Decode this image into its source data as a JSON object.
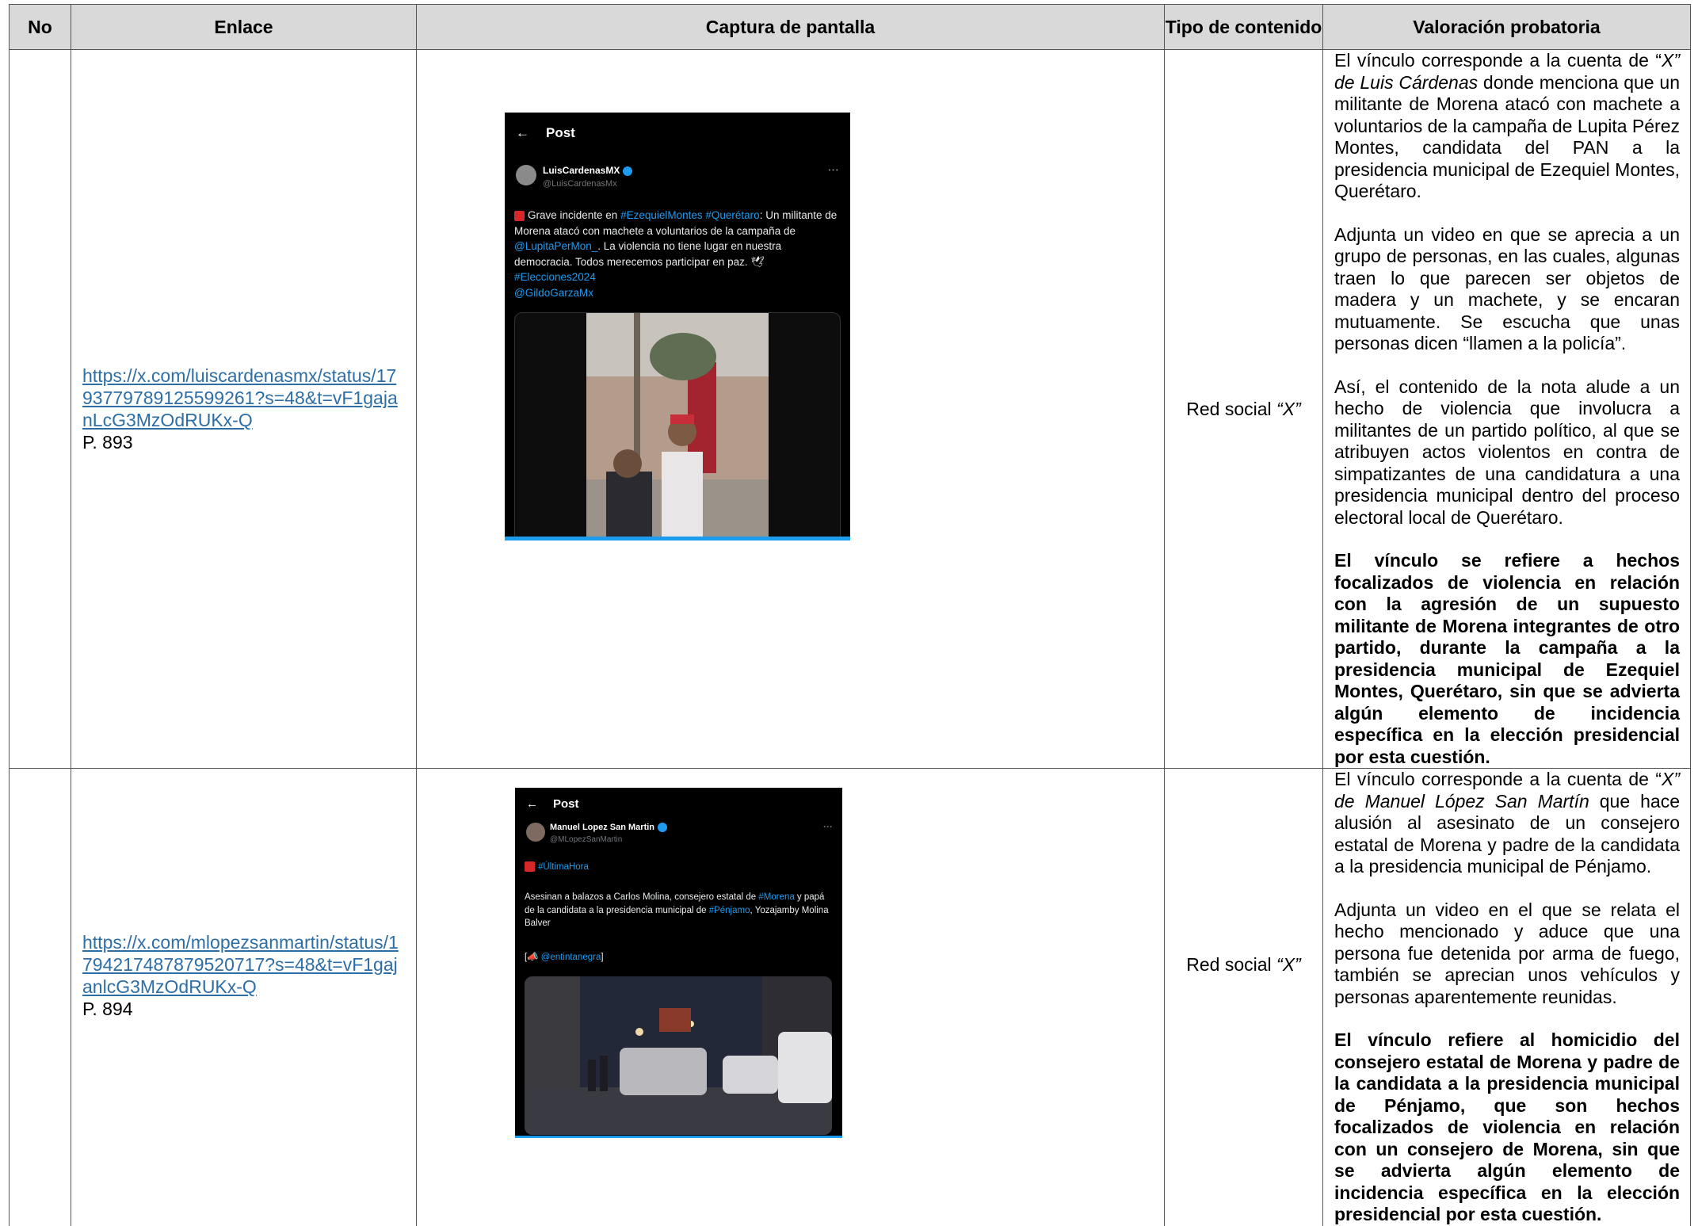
{
  "headers": {
    "no": "No",
    "link": "Enlace",
    "screenshot": "Captura de pantalla",
    "content_type": "Tipo de contenido",
    "assessment": "Valoración probatoria"
  },
  "rows": [
    {
      "link": "https://x.com/luiscardenasmx/status/1793779789125599261?s=48&t=vF1gajanLcG3MzOdRUKx-Q",
      "page": "P. 893",
      "content_type_prefix": "Red social ",
      "content_type_em": "“X”",
      "p1_pre": "El vínculo corresponde a la cuenta de “",
      "p1_em": "X” de Luis Cárdenas",
      "p1_post": " donde menciona que un militante de Morena atacó con machete a voluntarios de la campaña de Lupita Pérez Montes, candidata del PAN a la presidencia municipal de Ezequiel Montes, Querétaro.",
      "p2": "Adjunta un video en que se aprecia a un grupo de personas, en las cuales, algunas traen lo que parecen ser objetos de madera y un machete, y se encaran mutuamente. Se escucha que unas personas dicen “llamen a la policía”.",
      "p3": "Así, el contenido de la nota alude a un hecho de violencia que involucra a militantes de un partido político, al que se atribuyen actos violentos en contra de simpatizantes de una candidatura a una presidencia municipal dentro del proceso electoral local de Querétaro.",
      "p4": "El vínculo se refiere a hechos focalizados de violencia en relación con la agresión de un supuesto militante de Morena integrantes de otro partido, durante la campaña a la presidencia municipal de Ezequiel Montes, Querétaro, sin que se advierta algún elemento de incidencia específica en la elección presidencial por esta cuestión.",
      "tweet": {
        "header": "Post",
        "name": "LuisCardenasMX",
        "handle": "@LuisCardenasMx",
        "text_a": "Grave incidente en ",
        "tag_a": "#EzequielMontes #Querétaro",
        "text_b": ": Un militante de Morena atacó con machete a voluntarios de la campaña de ",
        "tag_b": "@LupitaPerMon_",
        "text_c": ". La violencia no tiene lugar en nuestra democracia. Todos merecemos participar en paz. ",
        "tag_c": "#Elecciones2024",
        "tag_d": "@GildoGarzaMx"
      }
    },
    {
      "link": "https://x.com/mlopezsanmartin/status/1794217487879520717?s=48&t=vF1gajanlcG3MzOdRUKx-Q",
      "page": "P. 894",
      "content_type_prefix": "Red social ",
      "content_type_em": "“X”",
      "p1_pre": "El vínculo corresponde a la cuenta de “",
      "p1_em": "X” de Manuel López San Martín",
      "p1_post": " que hace alusión al asesinato de un consejero estatal de Morena y padre de la candidata a la presidencia municipal de Pénjamo.",
      "p2": "Adjunta un video en el que se relata el hecho mencionado y aduce que una persona fue detenida por arma de fuego, también se aprecian unos vehículos y personas aparentemente reunidas.",
      "p4": "El vínculo refiere al homicidio del consejero estatal de Morena y padre de la candidata a la presidencia municipal de Pénjamo, que son hechos focalizados de violencia en relación con un consejero de Morena, sin que se advierta algún elemento de incidencia específica en la elección presidencial por esta cuestión.",
      "tweet": {
        "header": "Post",
        "name": "Manuel Lopez San Martin",
        "handle": "@MLopezSanMartin",
        "tag_a": "#ÚltimaHora",
        "text_b": "Asesinan a balazos a Carlos Molina, consejero estatal de ",
        "tag_b": "#Morena",
        "text_c": " y papá de la candidata a la presidencia municipal de ",
        "tag_c": "#Pénjamo",
        "text_d": ", Yozajamby Molina Balver",
        "tag_d": "@entintanegra"
      }
    }
  ],
  "colors": {
    "header_bg": "#d9d9d9",
    "link": "#2e6ea6",
    "tweet_bg": "#000000",
    "tweet_accent": "#1d9bf0"
  }
}
